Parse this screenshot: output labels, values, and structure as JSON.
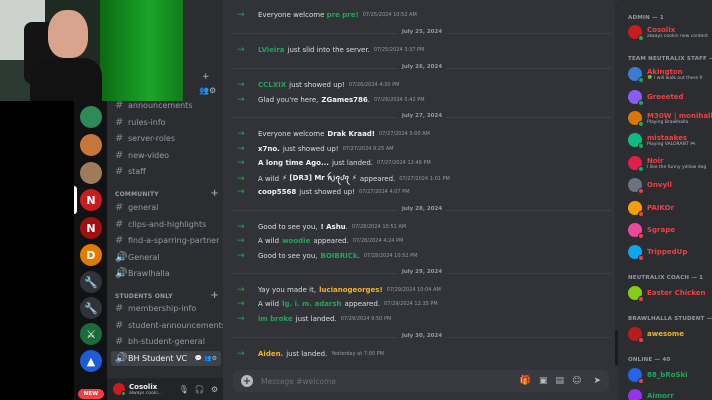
{
  "colors": {
    "bg_dark": "#111214",
    "sidebar": "#2b2d31",
    "chat": "#313338",
    "accent_green": "#23a55a",
    "staff_red": "#f23f43",
    "brawlhalla_yellow": "#f0b232"
  },
  "servers": [
    {
      "icon": "robot-server-icon",
      "color": "#2e8b57"
    },
    {
      "icon": "avatar-server-icon",
      "color": "#c7763a"
    },
    {
      "icon": "avatar-server-icon-2",
      "color": "#9e7b5a"
    },
    {
      "icon": "neutralix-server-icon",
      "color": "#c91c1c",
      "label": "N"
    },
    {
      "icon": "neutralix-red-icon",
      "color": "#a01010",
      "label": "N"
    },
    {
      "icon": "d-logo-server-icon",
      "color": "#e07b00",
      "label": "D"
    },
    {
      "icon": "wrench-server-icon",
      "color": "#30343a",
      "label": "🔧"
    },
    {
      "icon": "wrench-server-icon-2",
      "color": "#30343a",
      "label": "🔧"
    },
    {
      "icon": "brawl-server-icon",
      "color": "#1c6b3a",
      "label": "⚔"
    },
    {
      "icon": "blue-server-icon",
      "color": "#1e5bd6",
      "label": "▲"
    }
  ],
  "new_badge": "NEW",
  "channels_top": [
    {
      "name": "announcements",
      "icon": "#"
    },
    {
      "name": "rules-info",
      "icon": "#"
    },
    {
      "name": "server-roles",
      "icon": "#"
    },
    {
      "name": "new-video",
      "icon": "#"
    },
    {
      "name": "staff",
      "icon": "#"
    }
  ],
  "category_community": "COMMUNITY",
  "channels_community": [
    {
      "name": "general",
      "icon": "#"
    },
    {
      "name": "clips-and-highlights",
      "icon": "#"
    },
    {
      "name": "find-a-sparring-partner",
      "icon": "#"
    },
    {
      "name": "General",
      "icon": "🔊"
    },
    {
      "name": "Brawlhalla",
      "icon": "🔊"
    }
  ],
  "category_students": "STUDENTS ONLY",
  "channels_students": [
    {
      "name": "membership-info",
      "icon": "#"
    },
    {
      "name": "student-announcements",
      "icon": "#"
    },
    {
      "name": "bh-student-general",
      "icon": "#"
    },
    {
      "name": "BH Student VC",
      "icon": "🔊"
    }
  ],
  "user_panel": {
    "name": "Cosolix",
    "status": "always cooki..."
  },
  "chat": {
    "composer_placeholder": "Message #welcome",
    "top_partial": "Everyone welcome",
    "top_partial_name": "pre pre!",
    "top_partial_ts": "07/25/2024 10:52 AM",
    "days": [
      {
        "date": "July 25, 2024"
      },
      {
        "date": "July 26, 2024"
      },
      {
        "date": "July 27, 2024"
      },
      {
        "date": "July 28, 2024"
      },
      {
        "date": "July 29, 2024"
      },
      {
        "date": "July 30, 2024"
      }
    ],
    "messages": [
      {
        "name": "LVieira",
        "text": "just slid into the server.",
        "ts": "07/25/2024 3:37 PM",
        "prefix": ""
      },
      {
        "name": "CCLXIX",
        "text": "just showed up!",
        "ts": "07/26/2024 4:30 PM",
        "prefix": ""
      },
      {
        "name": "ZGames786",
        "text": ".",
        "ts": "07/26/2024 5:42 PM",
        "prefix": "Glad you're here,"
      },
      {
        "name": "Drak Kraad!",
        "text": "",
        "ts": "07/27/2024 5:00 AM",
        "prefix": "Everyone welcome"
      },
      {
        "name": "x7no.",
        "text": "just showed up!",
        "ts": "07/27/2024 9:25 AM",
        "prefix": ""
      },
      {
        "name": "A long time Ago...",
        "text": "just landed.",
        "ts": "07/27/2024 12:49 PM",
        "prefix": ""
      },
      {
        "name": "⚡ [DR3]  Mr ꫝ꠸ꪖᦔꪖ ⚡",
        "text": "appeared.",
        "ts": "07/27/2024 1:01 PM",
        "prefix": "A wild"
      },
      {
        "name": "coop5568",
        "text": "just showed up!",
        "ts": "07/27/2024 4:07 PM",
        "prefix": ""
      },
      {
        "name": "! Ashu",
        "text": ".",
        "ts": "07/28/2024 10:51 AM",
        "prefix": "Good to see you,"
      },
      {
        "name": "woodie",
        "text": "appeared.",
        "ts": "07/28/2024 4:24 PM",
        "prefix": "A wild"
      },
      {
        "name": "BOIBRICk",
        "text": ".",
        "ts": "07/28/2024 10:52 PM",
        "prefix": "Good to see you,"
      },
      {
        "name": "lucianogeorges!",
        "text": "",
        "ts": "07/29/2024 10:04 AM",
        "prefix": "Yay you made it,"
      },
      {
        "name": "lg. i. m. adarsh",
        "text": "appeared.",
        "ts": "07/29/2024 12:35 PM",
        "prefix": "A wild"
      },
      {
        "name": "im broke",
        "text": "just landed.",
        "ts": "07/29/2024 9:50 PM",
        "prefix": ""
      },
      {
        "name": "Aiden.",
        "text": "just landed.",
        "ts": "Yesterday at 7:00 PM",
        "prefix": ""
      }
    ]
  },
  "members": {
    "admin_header": "ADMIN — 1",
    "admin": [
      {
        "name": "Cosolix",
        "sub": "always cookin new content",
        "color": "#f23f43"
      }
    ],
    "staff_header": "TEAM NEUTRALIX STAFF — 9",
    "staff": [
      {
        "name": "Akington",
        "sub": "🍀 I will walk out there fr",
        "color": "#f23f43"
      },
      {
        "name": "Greeeted",
        "sub": "",
        "color": "#f23f43"
      },
      {
        "name": "M30W | monihalla",
        "sub": "Playing Brawlhalla",
        "color": "#f23f43"
      },
      {
        "name": "mistaakes",
        "sub": "Playing VALORANT 🎮",
        "color": "#f23f43"
      },
      {
        "name": "Noir",
        "sub": "I like the funny yellow dog",
        "color": "#f23f43"
      },
      {
        "name": "Onvyll",
        "sub": "",
        "color": "#f23f43"
      },
      {
        "name": "PAIKOr",
        "sub": "",
        "color": "#f23f43"
      },
      {
        "name": "Sgrape",
        "sub": "",
        "color": "#f23f43"
      },
      {
        "name": "TrippedUp",
        "sub": "",
        "color": "#f23f43"
      }
    ],
    "coach_header": "NEUTRALIX COACH — 1",
    "coach": [
      {
        "name": "Easter Chicken",
        "sub": "",
        "color": "#f23f43"
      }
    ],
    "student_header": "BRAWLHALLA STUDENT — 1",
    "student": [
      {
        "name": "awesome",
        "sub": "",
        "color": "#f0b232"
      }
    ],
    "online_header": "ONLINE — 40",
    "online": [
      {
        "name": "88_bRoSki",
        "sub": "",
        "color": "#23a55a"
      },
      {
        "name": "Aimorr",
        "sub": "",
        "color": "#23a55a"
      }
    ]
  }
}
